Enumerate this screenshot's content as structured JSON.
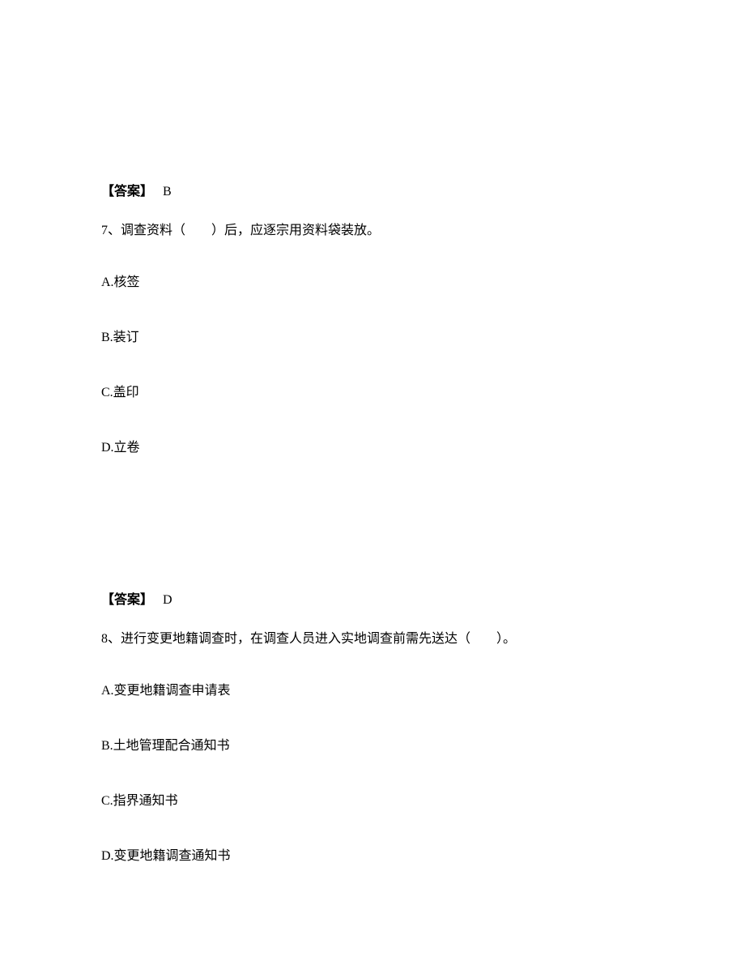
{
  "answer6": {
    "label": "【答案】",
    "value": "B"
  },
  "question7": {
    "num": "7、",
    "text": "调查资料（　　）后，应逐宗用资料袋装放。",
    "options": {
      "a": "A.核签",
      "b": "B.装订",
      "c": "C.盖印",
      "d": "D.立卷"
    }
  },
  "answer7": {
    "label": "【答案】",
    "value": "D"
  },
  "question8": {
    "num": "8、",
    "text": "进行变更地籍调查时，在调查人员进入实地调查前需先送达（　　）。",
    "options": {
      "a": "A.变更地籍调查申请表",
      "b": "B.土地管理配合通知书",
      "c": "C.指界通知书",
      "d": "D.变更地籍调查通知书"
    }
  }
}
